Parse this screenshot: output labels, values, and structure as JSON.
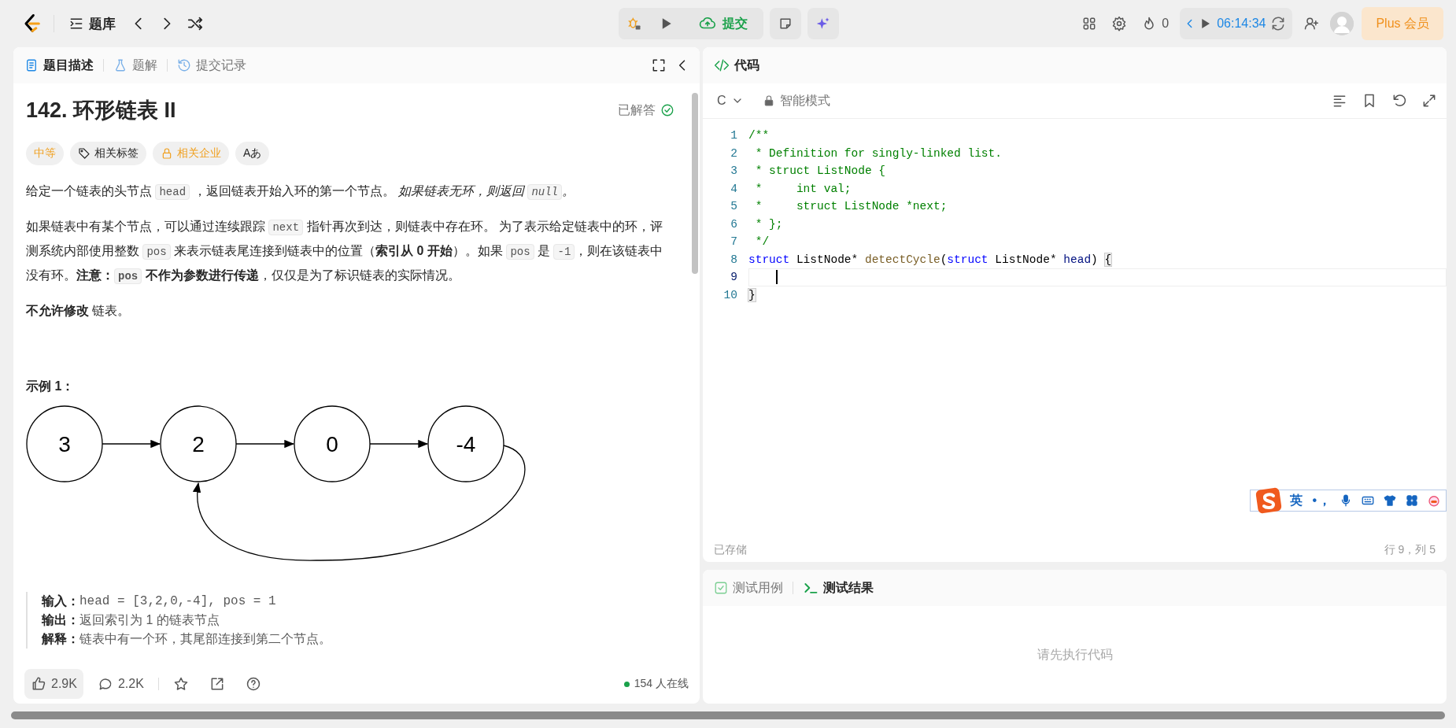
{
  "top_bar": {
    "problem_bank": "题库",
    "submit": "提交",
    "streak": "0",
    "timer": "06:14:34",
    "plus": "Plus 会员"
  },
  "left_tabs": [
    {
      "label": "题目描述",
      "kind": "doc",
      "selected": true
    },
    {
      "label": "题解",
      "kind": "flask",
      "selected": false
    },
    {
      "label": "提交记录",
      "kind": "history",
      "selected": false
    }
  ],
  "problem": {
    "title": "142. 环形链表 II",
    "status": "已解答",
    "tags": [
      {
        "label": "中等",
        "kind": "difficulty"
      },
      {
        "label": "相关标签",
        "kind": "tag"
      },
      {
        "label": "相关企业",
        "kind": "locked"
      },
      {
        "label": "Aあ",
        "kind": "translate"
      }
    ],
    "paragraphs": [
      [
        {
          "kind": "text",
          "text": "给定一个链表的头节点 "
        },
        {
          "kind": "code",
          "text": "head"
        },
        {
          "kind": "text",
          "text": " ，返回链表开始入环的第一个节点。 "
        },
        {
          "kind": "italic",
          "text": "如果链表无环，则返回 "
        },
        {
          "kind": "code_italic",
          "text": "null"
        },
        {
          "kind": "italic",
          "text": "。"
        }
      ],
      [
        {
          "kind": "text",
          "text": "如果链表中有某个节点，可以通过连续跟踪 "
        },
        {
          "kind": "code",
          "text": "next"
        },
        {
          "kind": "text",
          "text": " 指针再次到达，则链表中存在环。 为了表示给定链表中的环，评测系统内部使用整数 "
        },
        {
          "kind": "code",
          "text": "pos"
        },
        {
          "kind": "text",
          "text": " 来表示链表尾连接到链表中的位置（"
        },
        {
          "kind": "bold",
          "text": "索引从 0 开始"
        },
        {
          "kind": "text",
          "text": "）。如果 "
        },
        {
          "kind": "code",
          "text": "pos"
        },
        {
          "kind": "text",
          "text": " 是 "
        },
        {
          "kind": "code",
          "text": "-1"
        },
        {
          "kind": "text",
          "text": "，则在该链表中没有环。"
        },
        {
          "kind": "bold",
          "text": "注意："
        },
        {
          "kind": "code_bold",
          "text": "pos"
        },
        {
          "kind": "bold",
          "text": " 不作为参数进行传递"
        },
        {
          "kind": "text",
          "text": "，仅仅是为了标识链表的实际情况。"
        }
      ],
      [
        {
          "kind": "bold",
          "text": "不允许修改"
        },
        {
          "kind": "text",
          "text": " 链表。"
        }
      ]
    ],
    "example_title": "示例 1：",
    "diagram_nodes": [
      "3",
      "2",
      "0",
      "-4"
    ],
    "example_lines": [
      {
        "label": "输入：",
        "value": "head = [3,2,0,-4], pos = 1",
        "kind": "code"
      },
      {
        "label": "输出：",
        "value": "返回索引为 1 的链表节点",
        "kind": "text"
      },
      {
        "label": "解释：",
        "value": "链表中有一个环，其尾部连接到第二个节点。",
        "kind": "text"
      }
    ]
  },
  "left_footer": {
    "likes": "2.9K",
    "comments": "2.2K",
    "online": "154 人在线"
  },
  "code_panel": {
    "tab": "代码",
    "language": "C",
    "mode": "智能模式",
    "saved": "已存储",
    "cursor": "行 9，列 5",
    "lines": [
      {
        "number": "1",
        "active": false,
        "tokens": [
          {
            "kind": "comment",
            "text": "/**"
          }
        ]
      },
      {
        "number": "2",
        "active": false,
        "tokens": [
          {
            "kind": "comment",
            "text": " * Definition for singly-linked list."
          }
        ]
      },
      {
        "number": "3",
        "active": false,
        "tokens": [
          {
            "kind": "comment",
            "text": " * struct ListNode {"
          }
        ]
      },
      {
        "number": "4",
        "active": false,
        "tokens": [
          {
            "kind": "comment",
            "text": " *     int val;"
          }
        ]
      },
      {
        "number": "5",
        "active": false,
        "tokens": [
          {
            "kind": "comment",
            "text": " *     struct ListNode *next;"
          }
        ]
      },
      {
        "number": "6",
        "active": false,
        "tokens": [
          {
            "kind": "comment",
            "text": " * };"
          }
        ]
      },
      {
        "number": "7",
        "active": false,
        "tokens": [
          {
            "kind": "comment",
            "text": " */"
          }
        ]
      },
      {
        "number": "8",
        "active": false,
        "tokens": [
          {
            "kind": "keyword",
            "text": "struct"
          },
          {
            "kind": "plain",
            "text": " ListNode* "
          },
          {
            "kind": "function",
            "text": "detectCycle"
          },
          {
            "kind": "plain",
            "text": "("
          },
          {
            "kind": "keyword",
            "text": "struct"
          },
          {
            "kind": "plain",
            "text": " ListNode* "
          },
          {
            "kind": "param",
            "text": "head"
          },
          {
            "kind": "plain",
            "text": ") "
          },
          {
            "kind": "bracket",
            "text": "{"
          }
        ]
      },
      {
        "number": "9",
        "active": true
      },
      {
        "number": "10",
        "active": false,
        "tokens": [
          {
            "kind": "bracket",
            "text": "}"
          }
        ]
      }
    ]
  },
  "test_tabs": [
    {
      "label": "测试用例",
      "kind": "check",
      "selected": false
    },
    {
      "label": "测试结果",
      "kind": "terminal",
      "selected": true
    }
  ],
  "test_placeholder": "请先执行代码",
  "ime_toolbar": {
    "language": "英",
    "punctuation": "•，"
  }
}
